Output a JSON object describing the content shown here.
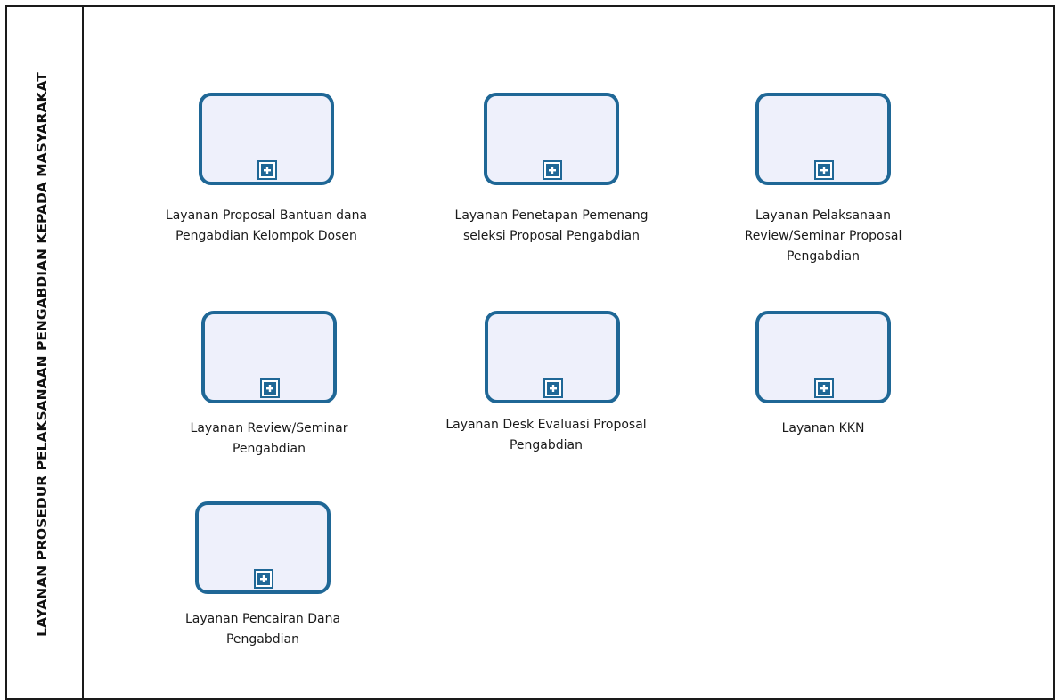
{
  "diagram": {
    "lane_title": "LAYANAN PROSEDUR PELAKSANAAN PENGABDIAN KEPADA MASYARAKAT",
    "marker_icon": "subprocess-plus-icon",
    "colors": {
      "task_border": "#1f6796",
      "task_fill": "#eef0fb",
      "pool_border": "#1a1a1a"
    },
    "tasks": [
      {
        "lines": [
          "Layanan Proposal Bantuan dana",
          "Pengabdian Kelompok Dosen"
        ]
      },
      {
        "lines": [
          "Layanan Penetapan Pemenang",
          "seleksi Proposal Pengabdian"
        ]
      },
      {
        "lines": [
          "Layanan Pelaksanaan",
          "Review/Seminar Proposal",
          "Pengabdian"
        ]
      },
      {
        "lines": [
          "Layanan Review/Seminar",
          "Pengabdian"
        ]
      },
      {
        "lines": [
          "Layanan Desk Evaluasi Proposal",
          "Pengabdian"
        ]
      },
      {
        "lines": [
          "Layanan KKN"
        ]
      },
      {
        "lines": [
          "Layanan Pencairan Dana",
          "Pengabdian"
        ]
      }
    ]
  }
}
